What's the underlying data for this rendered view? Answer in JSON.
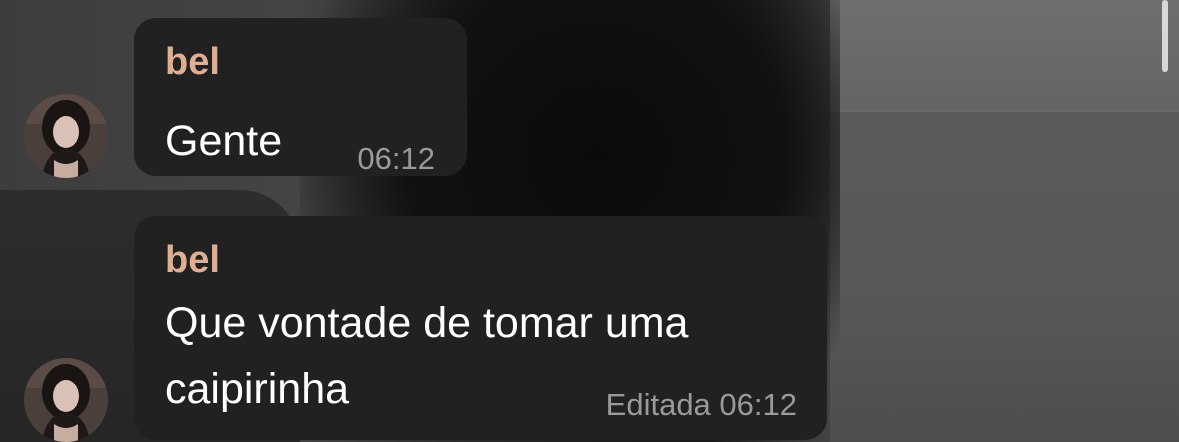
{
  "messages": [
    {
      "sender": "bel",
      "lines": [
        "Gente"
      ],
      "edited_label": "",
      "time": "06:12"
    },
    {
      "sender": "bel",
      "lines": [
        "Que vontade de tomar uma",
        "caipirinha"
      ],
      "edited_label": "Editada",
      "time": "06:12"
    }
  ],
  "colors": {
    "bubble_bg": "#212121",
    "sender_name": "#e0ae92",
    "message_text": "#ffffff",
    "meta_text": "#9a9a9a"
  }
}
